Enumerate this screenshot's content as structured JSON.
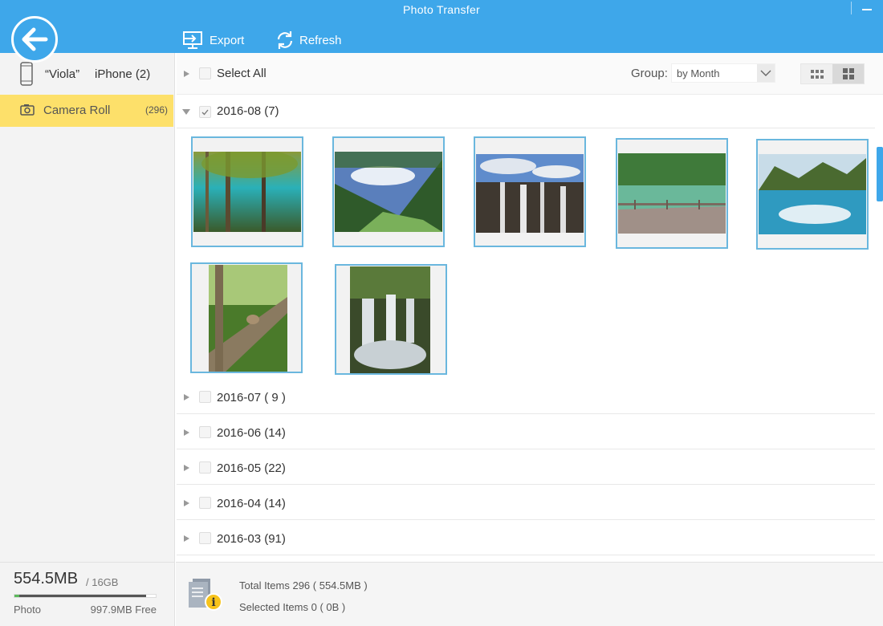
{
  "window": {
    "title": "Photo Transfer"
  },
  "toolbar": {
    "export_label": "Export",
    "refresh_label": "Refresh"
  },
  "sidebar": {
    "device_name": "“Viola”",
    "device_model": "iPhone (2)",
    "album": {
      "label": "Camera Roll",
      "count": "(296)"
    },
    "storage": {
      "used": "554.5MB",
      "total": "/ 16GB",
      "used_fraction": 0.93,
      "label": "Photo",
      "free": "997.9MB Free"
    }
  },
  "main": {
    "select_all_label": "Select All",
    "group_label": "Group:",
    "group_value": "by Month",
    "expanded_group": {
      "title": "2016-08 (7)",
      "photos": [
        {
          "name": "turquoise-pool-forest",
          "colors": [
            "#6b8a3a",
            "#2aa6b3",
            "#3f5a20"
          ]
        },
        {
          "name": "valley-river-trees",
          "colors": [
            "#4a6fa8",
            "#2f5a2a",
            "#6aa25a"
          ]
        },
        {
          "name": "waterfall-cliffs",
          "colors": [
            "#6f93c8",
            "#4a4038",
            "#d8d8d8"
          ]
        },
        {
          "name": "lake-boardwalk",
          "colors": [
            "#3f7a3a",
            "#6ab08a",
            "#9a8a80"
          ]
        },
        {
          "name": "mountain-lake-reflection",
          "colors": [
            "#5a7a3a",
            "#3aa0c0",
            "#bfdde8"
          ]
        },
        {
          "name": "bird-on-branch",
          "colors": [
            "#3f6a2a",
            "#8a7a60",
            "#a8c878"
          ]
        },
        {
          "name": "cascading-waterfall",
          "colors": [
            "#3a4a2a",
            "#d8dde0",
            "#5a7a4a"
          ]
        }
      ]
    },
    "collapsed_groups": [
      {
        "title": "2016-07 ( 9 )"
      },
      {
        "title": "2016-06 (14)"
      },
      {
        "title": "2016-05 (22)"
      },
      {
        "title": "2016-04 (14)"
      },
      {
        "title": "2016-03 (91)"
      }
    ]
  },
  "status": {
    "total": "Total Items 296 ( 554.5MB )",
    "selected": "Selected Items 0 ( 0B )"
  },
  "colors": {
    "accent": "#3ea7ea",
    "selected_album": "#fde06a",
    "thumb_border": "#6ab7de"
  }
}
